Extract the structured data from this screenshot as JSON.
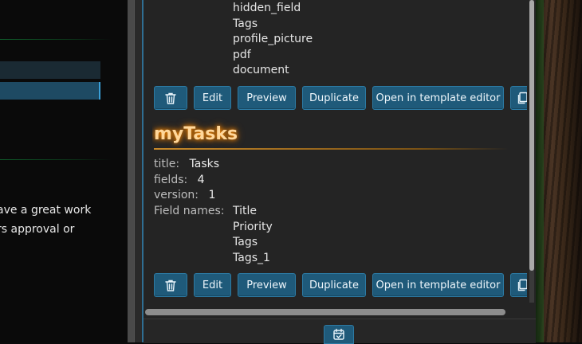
{
  "background_app": {
    "text_lines": [
      "ave a great work",
      "rs approval or"
    ]
  },
  "templates": [
    {
      "field_names_tail": [
        "hidden_field",
        "Tags",
        "profile_picture",
        "pdf",
        "document"
      ],
      "buttons": {
        "edit": "Edit",
        "preview": "Preview",
        "duplicate": "Duplicate",
        "open_editor": "Open in template editor"
      }
    },
    {
      "name": "myTasks",
      "title_label": "title:",
      "title_value": "Tasks",
      "fields_label": "fields:",
      "fields_value": "4",
      "version_label": "version:",
      "version_value": "1",
      "field_names_label": "Field names:",
      "field_names": [
        "Title",
        "Priority",
        "Tags",
        "Tags_1"
      ],
      "buttons": {
        "edit": "Edit",
        "preview": "Preview",
        "duplicate": "Duplicate",
        "open_editor": "Open in template editor"
      }
    }
  ],
  "icons": {
    "delete": "trash-icon",
    "copy": "copy-icon",
    "calendar": "calendar-icon"
  },
  "colors": {
    "accent": "#1f5a7a",
    "title_glow": "#ff8a00",
    "panel_bg": "#242424"
  }
}
